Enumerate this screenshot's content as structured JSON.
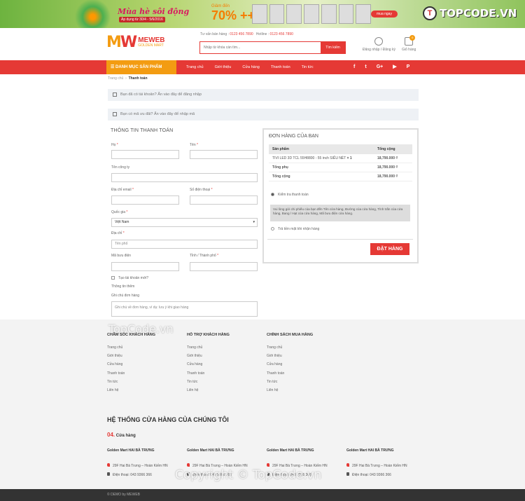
{
  "banner": {
    "slogan": "Mùa hè sôi động",
    "dates": "Áp dụng từ 30/4 - 5/6/2016",
    "discount_pre": "Giảm đến",
    "discount": "70% ++",
    "buy": "mua ngay"
  },
  "watermark": {
    "brand": "TOPCODE.VN",
    "mid": "TopCode.vn",
    "copy": "Copyright © TopCode.vn"
  },
  "header": {
    "logo_mark_a": "M",
    "logo_mark_b": "W",
    "logo_name": "MEWEB",
    "logo_sub": "GOLDEN MART",
    "consult_label": "Tư vấn bán hàng :",
    "consult_phone": "0123 456 7890",
    "hotline_label": "Hotline :",
    "hotline_phone": "0123 456 7890",
    "search_placeholder": "Nhập từ khóa cần tìm...",
    "search_button": "Tìm kiếm",
    "account_label": "Đăng nhập / Đăng ký",
    "cart_label": "Giỏ hàng",
    "cart_count": "0"
  },
  "nav": {
    "category": "DANH MỤC SẢN PHẨM",
    "items": [
      "Trang chủ",
      "Giới thiệu",
      "Cửa hàng",
      "Thanh toán",
      "Tin tức"
    ],
    "social": [
      "f",
      "t",
      "G+",
      "▶",
      "P"
    ]
  },
  "breadcrumb": {
    "home": "Trang chủ",
    "sep": "›",
    "current": "Thanh toán"
  },
  "notices": {
    "login": "Bạn đã có tài khoản? Ấn vào đây để đăng nhập",
    "coupon": "Bạn có mã ưu đãi? Ấn vào đây để nhập mã"
  },
  "billing": {
    "title": "THÔNG TIN THANH TOÁN",
    "last_name": "Họ",
    "first_name": "Tên",
    "company": "Tên công ty",
    "email": "Địa chỉ email",
    "phone": "Số điện thoại",
    "country": "Quốc gia",
    "country_value": "Việt Nam",
    "address": "Địa chỉ",
    "address_placeholder": "Tên phố",
    "postcode": "Mã bưu điện",
    "city": "Tỉnh / Thành phố",
    "create_account": "Tạo tài khoản mới?",
    "more_info": "Thông tin thêm",
    "notes": "Ghi chú đơn hàng",
    "notes_placeholder": "Ghi chú về đơn hàng, ví dụ: lưu ý khi giao hàng",
    "required": "*"
  },
  "order": {
    "title": "ĐƠN HÀNG CỦA BẠN",
    "col_product": "Sản phẩm",
    "col_total": "Tổng cộng",
    "item_name": "TIVI LED 3D TCL 55H8800 - 55 inch SIÊU NÉT",
    "item_qty": "× 1",
    "item_price": "18,790.000 ₫",
    "subtotal_label": "Tổng phụ",
    "subtotal": "18,790.000 ₫",
    "total_label": "Tổng cộng",
    "total": "18,790.000 ₫",
    "pay_check": "Kiểm tra thanh toán",
    "pay_check_desc": "Vui lòng gửi chi phiếu của bạn đến Tên cửa hàng, Đường của cửa hàng, Tỉnh trấn của cửa hàng, Bang / Hạt của cửa hàng, Mã bưu điện cửa hàng.",
    "pay_cod": "Trả tiền mặt khi nhận hàng",
    "place_order": "ĐẶT HÀNG"
  },
  "footer": {
    "columns": [
      {
        "title": "CHĂM SÓC KHÁCH HÀNG",
        "links": [
          "Trang chủ",
          "Giới thiệu",
          "Cửa hàng",
          "Thanh toán",
          "Tin tức",
          "Liên hệ"
        ]
      },
      {
        "title": "HỖ TRỢ KHÁCH HÀNG",
        "links": [
          "Trang chủ",
          "Giới thiệu",
          "Cửa hàng",
          "Thanh toán",
          "Tin tức",
          "Liên hệ"
        ]
      },
      {
        "title": "CHÍNH SÁCH MUA HÀNG",
        "links": [
          "Trang chủ",
          "Giới thiệu",
          "Cửa hàng",
          "Thanh toán",
          "Tin tức",
          "Liên hệ"
        ]
      }
    ],
    "system_title": "HỆ THỐNG CỬA HÀNG CỦA CHÚNG TÔI",
    "store_count": "04.",
    "store_count_label": "Cửa hàng",
    "stores": [
      {
        "name": "Golden Mart HAI BÀ TRƯNG",
        "addr": "29F Hai Bà Trưng – Hoàn Kiếm HN",
        "phone": "Điện thoại: 043 9366 366"
      },
      {
        "name": "Golden Mart HAI BÀ TRƯNG",
        "addr": "29F Hai Bà Trưng – Hoàn Kiếm HN",
        "phone": "Điện thoại: 043 9366 366"
      },
      {
        "name": "Golden Mart HAI BÀ TRƯNG",
        "addr": "29F Hai Bà Trưng – Hoàn Kiếm HN",
        "phone": "Điện thoại: 043 9366 366"
      },
      {
        "name": "Golden Mart HAI BÀ TRƯNG",
        "addr": "29F Hai Bà Trưng – Hoàn Kiếm HN",
        "phone": "Điện thoại: 043 9366 366"
      }
    ],
    "copyright": "© DEMO by MEWEB"
  }
}
